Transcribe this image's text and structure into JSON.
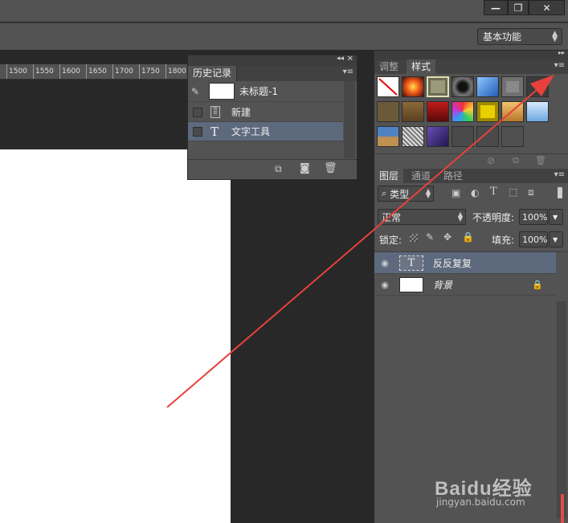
{
  "window": {
    "min_label": "—",
    "restore_label": "❐",
    "close_label": "✕"
  },
  "optionsbar": {
    "workspace": "基本功能"
  },
  "ruler": {
    "ticks": [
      "1500",
      "1550",
      "1600",
      "1650",
      "1700",
      "1750",
      "1800"
    ]
  },
  "history": {
    "title": "历史记录",
    "snapshot_name": "未标题-1",
    "items": [
      {
        "label": "新建",
        "icon": "document-icon",
        "selected": false
      },
      {
        "label": "文字工具",
        "icon": "text-tool-icon",
        "selected": true
      }
    ]
  },
  "styles_panel": {
    "tabs": [
      {
        "label": "调整",
        "active": false
      },
      {
        "label": "样式",
        "active": true
      }
    ]
  },
  "layers_panel": {
    "tabs": [
      {
        "label": "图层",
        "active": true
      },
      {
        "label": "通道",
        "active": false
      },
      {
        "label": "路径",
        "active": false
      }
    ],
    "filter_kind": "类型",
    "blend_mode": "正常",
    "opacity_label": "不透明度:",
    "opacity_value": "100%",
    "lock_label": "锁定:",
    "fill_label": "填充:",
    "fill_value": "100%",
    "layers": [
      {
        "name": "反反复复",
        "type": "text",
        "selected": true
      },
      {
        "name": "背景",
        "type": "background",
        "locked": true,
        "selected": false
      }
    ]
  },
  "watermark": {
    "brand": "Baidu经验",
    "sub": "jingyan.baidu.com"
  },
  "annotation": {
    "arrow_color": "#e8413c"
  }
}
